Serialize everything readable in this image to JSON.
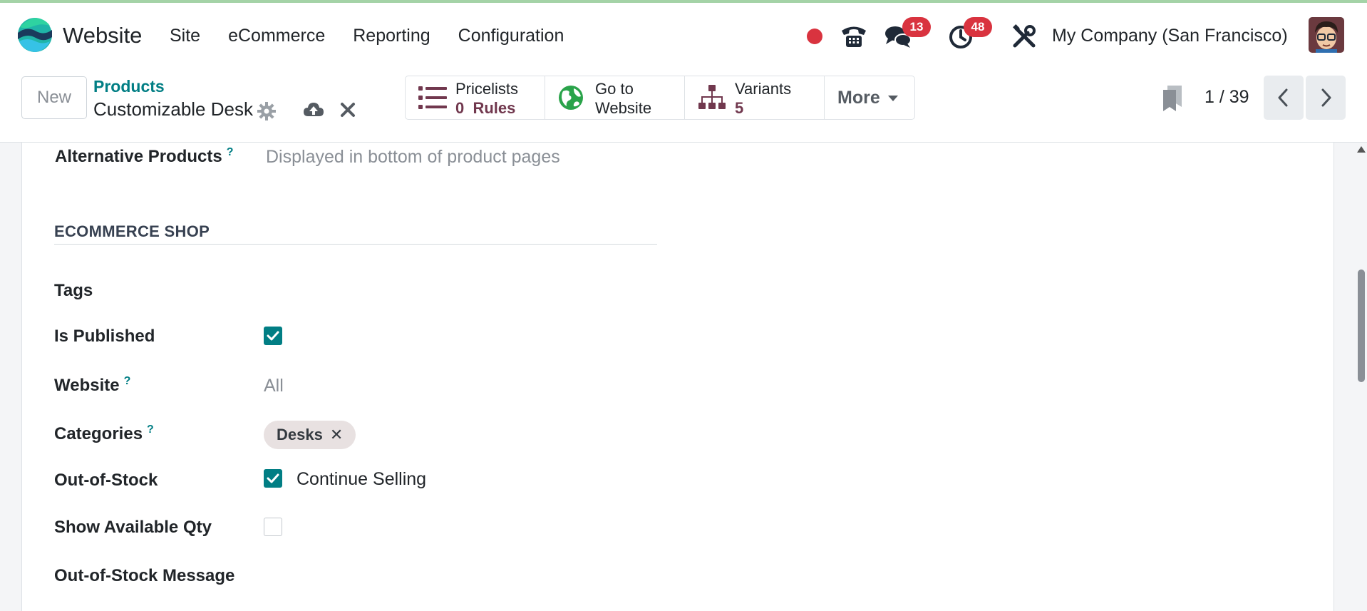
{
  "navbar": {
    "app_name": "Website",
    "menu": [
      "Site",
      "eCommerce",
      "Reporting",
      "Configuration"
    ],
    "messages_count": "13",
    "activities_count": "48",
    "company": "My Company (San Francisco)"
  },
  "control_panel": {
    "new_label": "New",
    "breadcrumb_parent": "Products",
    "breadcrumb_current": "Customizable Desk",
    "smart_buttons": {
      "pricelists": {
        "line1": "Pricelists",
        "number": "0",
        "line2": "Rules"
      },
      "website": {
        "line1": "Go to",
        "line2": "Website"
      },
      "variants": {
        "line1": "Variants",
        "number": "5"
      },
      "more_label": "More"
    },
    "pager": "1 / 39"
  },
  "form": {
    "alternative_products": {
      "label": "Alternative Products",
      "tip": "?",
      "placeholder": "Displayed in bottom of product pages"
    },
    "section_title": "ECOMMERCE SHOP",
    "tags": {
      "label": "Tags"
    },
    "is_published": {
      "label": "Is Published",
      "checked": true
    },
    "website": {
      "label": "Website",
      "tip": "?",
      "value": "All"
    },
    "categories": {
      "label": "Categories",
      "tip": "?",
      "tag": "Desks"
    },
    "out_of_stock": {
      "label": "Out-of-Stock",
      "checked": true,
      "text": "Continue Selling"
    },
    "show_available_qty": {
      "label": "Show Available Qty",
      "checked": false
    },
    "out_of_stock_message": {
      "label": "Out-of-Stock Message"
    }
  },
  "colors": {
    "accent": "#017e84",
    "badge": "#d9333f",
    "smart_number": "#71384e"
  }
}
